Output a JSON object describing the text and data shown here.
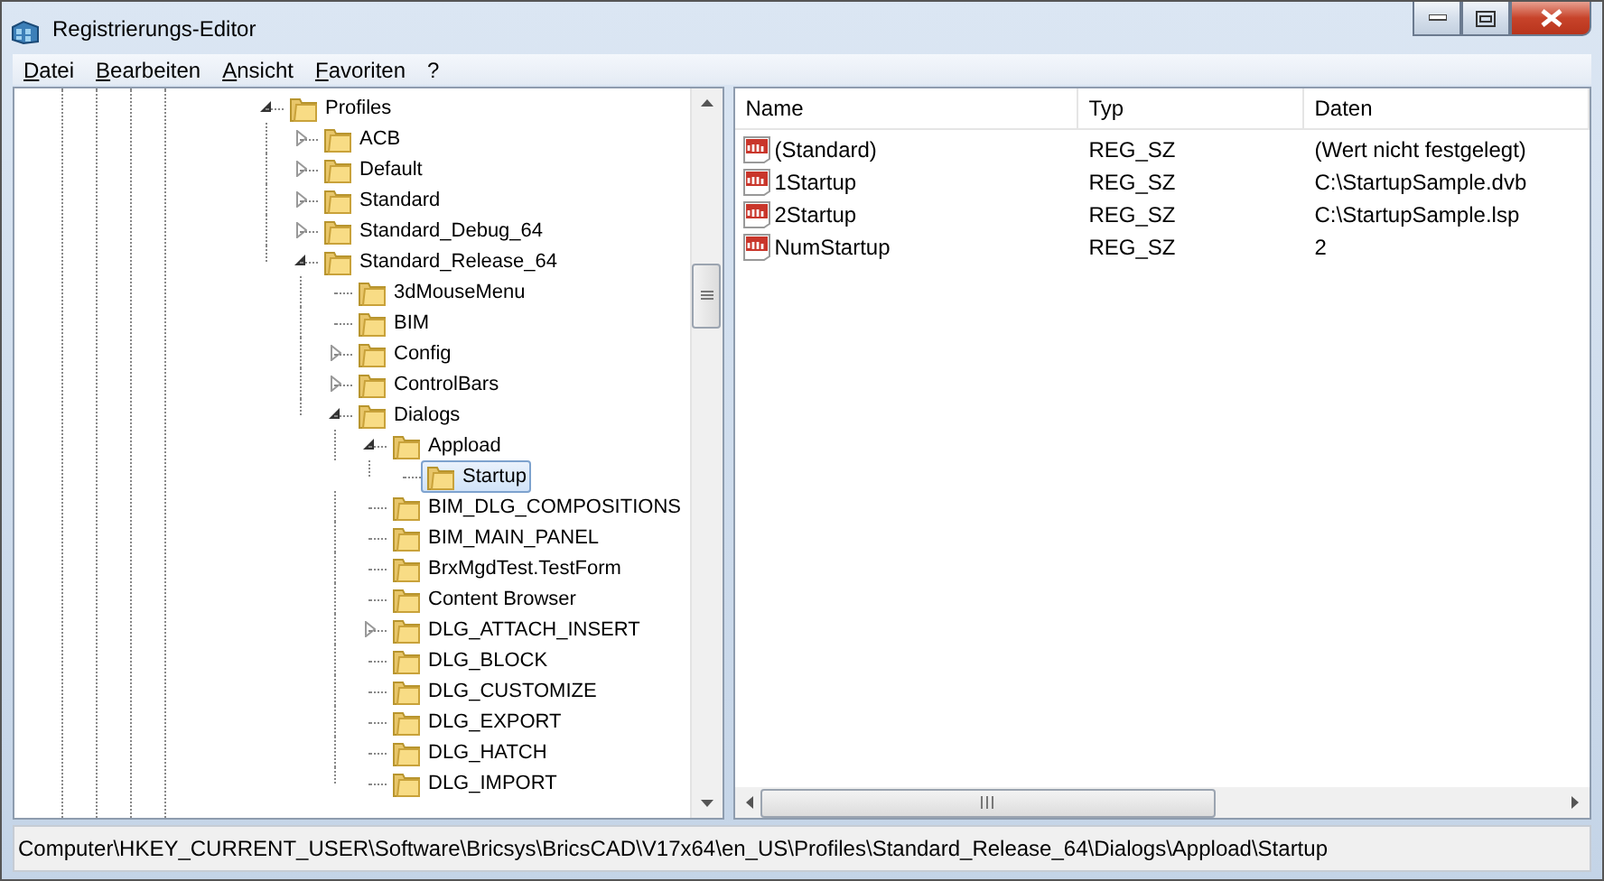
{
  "window": {
    "title": "Registrierungs-Editor"
  },
  "menu": [
    "Datei",
    "Bearbeiten",
    "Ansicht",
    "Favoriten",
    "?"
  ],
  "tree": [
    {
      "label": "Profiles",
      "expandable": true,
      "expanded": true,
      "selected": false,
      "children": [
        {
          "label": "ACB",
          "expandable": true,
          "expanded": false,
          "selected": false
        },
        {
          "label": "Default",
          "expandable": true,
          "expanded": false,
          "selected": false
        },
        {
          "label": "Standard",
          "expandable": true,
          "expanded": false,
          "selected": false
        },
        {
          "label": "Standard_Debug_64",
          "expandable": true,
          "expanded": false,
          "selected": false
        },
        {
          "label": "Standard_Release_64",
          "expandable": true,
          "expanded": true,
          "selected": false,
          "children": [
            {
              "label": "3dMouseMenu",
              "expandable": false,
              "selected": false
            },
            {
              "label": "BIM",
              "expandable": false,
              "selected": false
            },
            {
              "label": "Config",
              "expandable": true,
              "expanded": false,
              "selected": false
            },
            {
              "label": "ControlBars",
              "expandable": true,
              "expanded": false,
              "selected": false
            },
            {
              "label": "Dialogs",
              "expandable": true,
              "expanded": true,
              "selected": false,
              "children": [
                {
                  "label": "Appload",
                  "expandable": true,
                  "expanded": true,
                  "selected": false,
                  "children": [
                    {
                      "label": "Startup",
                      "expandable": false,
                      "selected": true
                    }
                  ]
                },
                {
                  "label": "BIM_DLG_COMPOSITIONS",
                  "expandable": false,
                  "selected": false
                },
                {
                  "label": "BIM_MAIN_PANEL",
                  "expandable": false,
                  "selected": false
                },
                {
                  "label": "BrxMgdTest.TestForm",
                  "expandable": false,
                  "selected": false
                },
                {
                  "label": "Content Browser",
                  "expandable": false,
                  "selected": false
                },
                {
                  "label": "DLG_ATTACH_INSERT",
                  "expandable": true,
                  "expanded": false,
                  "selected": false
                },
                {
                  "label": "DLG_BLOCK",
                  "expandable": false,
                  "selected": false
                },
                {
                  "label": "DLG_CUSTOMIZE",
                  "expandable": false,
                  "selected": false
                },
                {
                  "label": "DLG_EXPORT",
                  "expandable": false,
                  "selected": false
                },
                {
                  "label": "DLG_HATCH",
                  "expandable": false,
                  "selected": false
                },
                {
                  "label": "DLG_IMPORT",
                  "expandable": false,
                  "selected": false
                }
              ]
            }
          ]
        }
      ]
    }
  ],
  "values": {
    "columns": [
      "Name",
      "Typ",
      "Daten"
    ],
    "rows": [
      {
        "name": "(Standard)",
        "type": "REG_SZ",
        "data": "(Wert nicht festgelegt)"
      },
      {
        "name": "1Startup",
        "type": "REG_SZ",
        "data": "C:\\StartupSample.dvb"
      },
      {
        "name": "2Startup",
        "type": "REG_SZ",
        "data": "C:\\StartupSample.lsp"
      },
      {
        "name": "NumStartup",
        "type": "REG_SZ",
        "data": "2"
      }
    ]
  },
  "status_bar": "Computer\\HKEY_CURRENT_USER\\Software\\Bricsys\\BricsCAD\\V17x64\\en_US\\Profiles\\Standard_Release_64\\Dialogs\\Appload\\Startup"
}
